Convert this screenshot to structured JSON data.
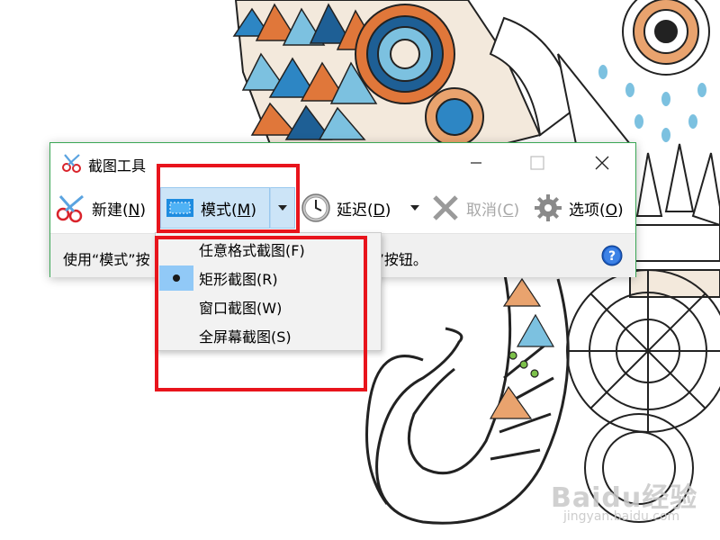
{
  "window": {
    "title": "截图工具",
    "border_color": "#3aa655"
  },
  "titlebar": {
    "minimize_icon": "minimize-icon",
    "maximize_icon": "maximize-icon",
    "close_icon": "close-icon"
  },
  "toolbar": {
    "new_label": "新建(",
    "new_key": "N",
    "new_suffix": ")",
    "mode_label": "模式(",
    "mode_key": "M",
    "mode_suffix": ")",
    "delay_label": "延迟(",
    "delay_key": "D",
    "delay_suffix": ")",
    "cancel_label": "取消(",
    "cancel_key": "C",
    "cancel_suffix": ")",
    "options_label": "选项(",
    "options_key": "O",
    "options_suffix": ")",
    "active_bg": "#cce4f7"
  },
  "status": {
    "text_left": "使用“模式”按",
    "text_right": "”按钮。"
  },
  "mode_menu": {
    "items": [
      {
        "label": "任意格式截图(F)",
        "checked": false
      },
      {
        "label": "矩形截图(R)",
        "checked": true
      },
      {
        "label": "窗口截图(W)",
        "checked": false
      },
      {
        "label": "全屏幕截图(S)",
        "checked": false
      }
    ],
    "check_bg": "#91c9f7"
  },
  "annotations": {
    "color": "#e8141c"
  },
  "watermark": {
    "brand": "Baidu经验",
    "url": "jingyan.baidu.com"
  }
}
